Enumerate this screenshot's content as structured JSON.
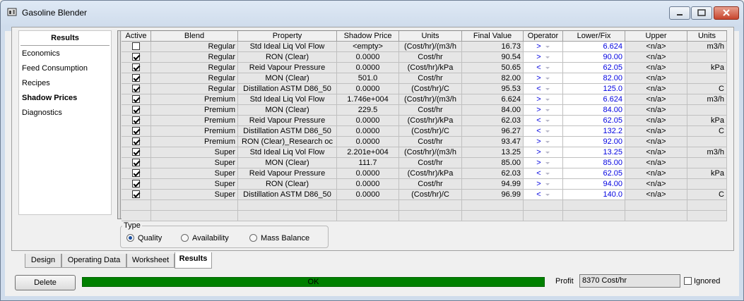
{
  "window": {
    "title": "Gasoline Blender"
  },
  "nav": {
    "header": "Results",
    "items": [
      {
        "label": "Economics",
        "active": false
      },
      {
        "label": "Feed Consumption",
        "active": false
      },
      {
        "label": "Recipes",
        "active": false
      },
      {
        "label": "Shadow Prices",
        "active": true
      },
      {
        "label": "Diagnostics",
        "active": false
      }
    ]
  },
  "table": {
    "columns": [
      "Active",
      "Blend",
      "Property",
      "Shadow Price",
      "Units",
      "Final Value",
      "Operator",
      "Lower/Fix",
      "Upper",
      "Units"
    ],
    "rows": [
      {
        "active": false,
        "blend": "Regular",
        "property": "Std Ideal Liq Vol Flow",
        "shadow": "<empty>",
        "units": "(Cost/hr)/(m3/h",
        "final": "16.73",
        "op": ">",
        "lower": "6.624",
        "upper": "<n/a>",
        "units2": "m3/h"
      },
      {
        "active": true,
        "blend": "Regular",
        "property": "RON (Clear)",
        "shadow": "0.0000",
        "units": "Cost/hr",
        "final": "90.54",
        "op": ">",
        "lower": "90.00",
        "upper": "<n/a>",
        "units2": ""
      },
      {
        "active": true,
        "blend": "Regular",
        "property": "Reid Vapour Pressure",
        "shadow": "0.0000",
        "units": "(Cost/hr)/kPa",
        "final": "50.65",
        "op": "<",
        "lower": "62.05",
        "upper": "<n/a>",
        "units2": "kPa"
      },
      {
        "active": true,
        "blend": "Regular",
        "property": "MON (Clear)",
        "shadow": "501.0",
        "units": "Cost/hr",
        "final": "82.00",
        "op": ">",
        "lower": "82.00",
        "upper": "<n/a>",
        "units2": ""
      },
      {
        "active": true,
        "blend": "Regular",
        "property": "Distillation ASTM D86_50",
        "shadow": "0.0000",
        "units": "(Cost/hr)/C",
        "final": "95.53",
        "op": "<",
        "lower": "125.0",
        "upper": "<n/a>",
        "units2": "C"
      },
      {
        "active": true,
        "blend": "Premium",
        "property": "Std Ideal Liq Vol Flow",
        "shadow": "1.746e+004",
        "units": "(Cost/hr)/(m3/h",
        "final": "6.624",
        "op": ">",
        "lower": "6.624",
        "upper": "<n/a>",
        "units2": "m3/h"
      },
      {
        "active": true,
        "blend": "Premium",
        "property": "MON (Clear)",
        "shadow": "229.5",
        "units": "Cost/hr",
        "final": "84.00",
        "op": ">",
        "lower": "84.00",
        "upper": "<n/a>",
        "units2": ""
      },
      {
        "active": true,
        "blend": "Premium",
        "property": "Reid Vapour Pressure",
        "shadow": "0.0000",
        "units": "(Cost/hr)/kPa",
        "final": "62.03",
        "op": "<",
        "lower": "62.05",
        "upper": "<n/a>",
        "units2": "kPa"
      },
      {
        "active": true,
        "blend": "Premium",
        "property": "Distillation ASTM D86_50",
        "shadow": "0.0000",
        "units": "(Cost/hr)/C",
        "final": "96.27",
        "op": "<",
        "lower": "132.2",
        "upper": "<n/a>",
        "units2": "C"
      },
      {
        "active": true,
        "blend": "Premium",
        "property": "RON (Clear)_Research oc",
        "shadow": "0.0000",
        "units": "Cost/hr",
        "final": "93.47",
        "op": ">",
        "lower": "92.00",
        "upper": "<n/a>",
        "units2": ""
      },
      {
        "active": true,
        "blend": "Super",
        "property": "Std Ideal Liq Vol Flow",
        "shadow": "2.201e+004",
        "units": "(Cost/hr)/(m3/h",
        "final": "13.25",
        "op": ">",
        "lower": "13.25",
        "upper": "<n/a>",
        "units2": "m3/h"
      },
      {
        "active": true,
        "blend": "Super",
        "property": "MON (Clear)",
        "shadow": "111.7",
        "units": "Cost/hr",
        "final": "85.00",
        "op": ">",
        "lower": "85.00",
        "upper": "<n/a>",
        "units2": ""
      },
      {
        "active": true,
        "blend": "Super",
        "property": "Reid Vapour Pressure",
        "shadow": "0.0000",
        "units": "(Cost/hr)/kPa",
        "final": "62.03",
        "op": "<",
        "lower": "62.05",
        "upper": "<n/a>",
        "units2": "kPa"
      },
      {
        "active": true,
        "blend": "Super",
        "property": "RON (Clear)",
        "shadow": "0.0000",
        "units": "Cost/hr",
        "final": "94.99",
        "op": ">",
        "lower": "94.00",
        "upper": "<n/a>",
        "units2": ""
      },
      {
        "active": true,
        "blend": "Super",
        "property": "Distillation ASTM D86_50",
        "shadow": "0.0000",
        "units": "(Cost/hr)/C",
        "final": "96.99",
        "op": "<",
        "lower": "140.0",
        "upper": "<n/a>",
        "units2": "C"
      }
    ]
  },
  "type_group": {
    "legend": "Type",
    "options": [
      {
        "label": "Quality",
        "selected": true
      },
      {
        "label": "Availability",
        "selected": false
      },
      {
        "label": "Mass Balance",
        "selected": false
      }
    ]
  },
  "tabs": [
    {
      "label": "Design",
      "active": false
    },
    {
      "label": "Operating Data",
      "active": false
    },
    {
      "label": "Worksheet",
      "active": false
    },
    {
      "label": "Results",
      "active": true
    }
  ],
  "bottom": {
    "delete_label": "Delete",
    "status_text": "OK",
    "status_color": "#008000",
    "profit_label": "Profit",
    "profit_value": "8370 Cost/hr",
    "ignored_label": "Ignored"
  }
}
